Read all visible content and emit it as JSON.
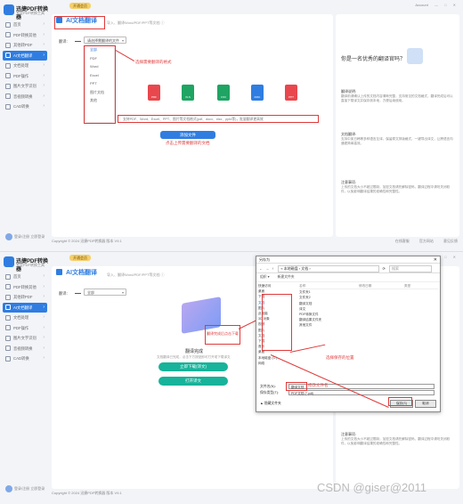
{
  "app": {
    "name": "迅捷PDF转换器",
    "subtitle": "专业PDF转换工具",
    "vip_label": "开通会员",
    "account": "Account",
    "window_controls": [
      "—",
      "□",
      "✕"
    ]
  },
  "sidebar": {
    "items": [
      {
        "label": "首页"
      },
      {
        "label": "PDF转换其他"
      },
      {
        "label": "其他转PDF"
      },
      {
        "label": "AI文档翻译"
      },
      {
        "label": "文档处理"
      },
      {
        "label": "PDF操作"
      },
      {
        "label": "图片文字识别"
      },
      {
        "label": "音视频转换"
      },
      {
        "label": "CAD转换"
      }
    ],
    "user": "登录/注册 立即登录"
  },
  "screen1": {
    "title": "AI文档翻译",
    "subtitle": "导入、翻译Word/PDF/PPT等文档 ⓘ",
    "format_label": "翻译:",
    "selected_format": "请选择需翻译的文件",
    "dropdown_options": [
      "全部",
      "PDF",
      "Word",
      "Excel",
      "PPT",
      "图片文档",
      "其他"
    ],
    "annotation_dropdown": "选择需要翻译的格式",
    "file_types": [
      {
        "label": "PDF",
        "color": "#e8474d"
      },
      {
        "label": "XLS",
        "color": "#1fa463"
      },
      {
        "label": "CSV",
        "color": "#1fa463"
      },
      {
        "label": "DOC",
        "color": "#2f7de1"
      },
      {
        "label": "PPT",
        "color": "#e8474d"
      }
    ],
    "supported": "支持PDF、Word、Excel、PPT、图片等文档格式(pdf、docx、xlsx、pptx等)，批量翻译更高效",
    "add_button": "添加文件",
    "annotation_add": "点击上传需要翻译的文档",
    "right_panel": {
      "title": "你是一名优秀的翻译官吗？",
      "sections": [
        {
          "heading": "翻译说明:",
          "text": "翻译前请确认上传的文档内容清晰完整，支持常见的文档格式，翻译完成后可以直接下载译文并保存到本地，方便后续使用。"
        },
        {
          "heading": "文档翻译:",
          "text": "支持中英日韩等多种语言互译，保留原文排版格式，一键导出译文，让跨语言沟通更简单高效。"
        },
        {
          "heading": "注意事项:",
          "text": "上传的文档大小不超过限制，加密文档请先解除密码，翻译过程中请勿关闭软件，以免影响翻译结果的准确性和完整性。"
        }
      ]
    }
  },
  "screen2": {
    "title": "AI文档翻译",
    "subtitle": "导入、翻译Word/PDF/PPT等文档 ⓘ",
    "format_label": "翻译:",
    "selected_format": "全部",
    "done_text": "翻译完成",
    "done_sub": "文档翻译已完成，点击下方按钮即可打开或下载译文",
    "annotation_result": "翻译完成后点击下载",
    "download_button": "立即下载(译文)",
    "open_button": "打开译文",
    "annotation_save": "选择保存的位置",
    "annotation_name": "修改文件名",
    "right_panel": {
      "section": {
        "heading": "注意事项:",
        "text": "上传的文档大小不超过限制，加密文档请先解除密码，翻译过程中请勿关闭软件，以免影响翻译结果的准确性和完整性。"
      }
    }
  },
  "dialog": {
    "title": "另存为",
    "path": "« 本地磁盘 › 文档 ›",
    "search_placeholder": "搜索",
    "toolbar": [
      "组织 ▾",
      "新建文件夹"
    ],
    "tree": [
      "快速访问",
      "桌面",
      "下载",
      "文档",
      "图片",
      "此电脑",
      "3D 对象",
      "视频",
      "图片",
      "文档",
      "下载",
      "音乐",
      "桌面",
      "本地磁盘 (C:)",
      "网络"
    ],
    "tree_highlight_index": 3,
    "columns": [
      "名称",
      "修改日期",
      "类型"
    ],
    "files": [
      "文件夹1",
      "文件夹2",
      "翻译文档",
      "译文",
      "PDF转换文件",
      "翻译结果文件夹",
      "其他文件"
    ],
    "filename_label": "文件名(N):",
    "filename_value": "翻译文档",
    "filetype_label": "保存类型(T):",
    "filetype_value": "PDF文档 (*.pdf)",
    "hide_folders": "▲ 隐藏文件夹",
    "save_button": "保存(S)",
    "cancel_button": "取消"
  },
  "footer": {
    "copyright": "Copyright © 2024 迅捷PDF转换器 版本 V9.1",
    "links": [
      "在线客服",
      "官方网站",
      "意见反馈"
    ]
  },
  "watermark": "CSDN @giser@2011"
}
